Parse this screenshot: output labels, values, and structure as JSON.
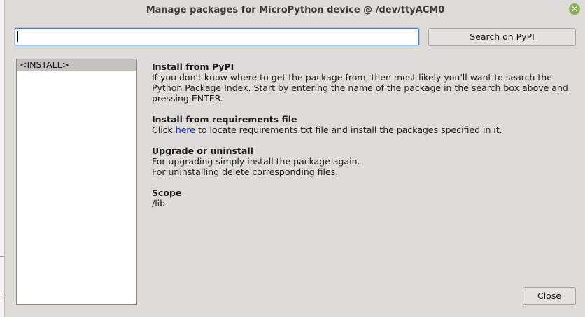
{
  "window": {
    "title": "Manage packages for MicroPython device @ /dev/ttyACM0",
    "close_glyph": "✕"
  },
  "search": {
    "value": "",
    "button_label": "Search on PyPI"
  },
  "package_list": {
    "items": [
      "<INSTALL>"
    ],
    "selected": "<INSTALL>"
  },
  "info": {
    "install_pypi": {
      "heading": "Install from PyPI",
      "text": "If you don't know where to get the package from, then most likely you'll want to search the Python Package Index. Start by entering the name of the package in the search box above and pressing ENTER."
    },
    "install_requirements": {
      "heading": "Install from requirements file",
      "prefix": "Click",
      "link": "here",
      "suffix": "to locate requirements.txt file and install the packages specified in it."
    },
    "upgrade": {
      "heading": "Upgrade or uninstall",
      "line1": "For upgrading simply install the package again.",
      "line2": "For uninstalling delete corresponding files."
    },
    "scope": {
      "heading": "Scope",
      "value": "/lib"
    }
  },
  "footer": {
    "close_label": "Close"
  },
  "background": {
    "fragment": "i"
  }
}
